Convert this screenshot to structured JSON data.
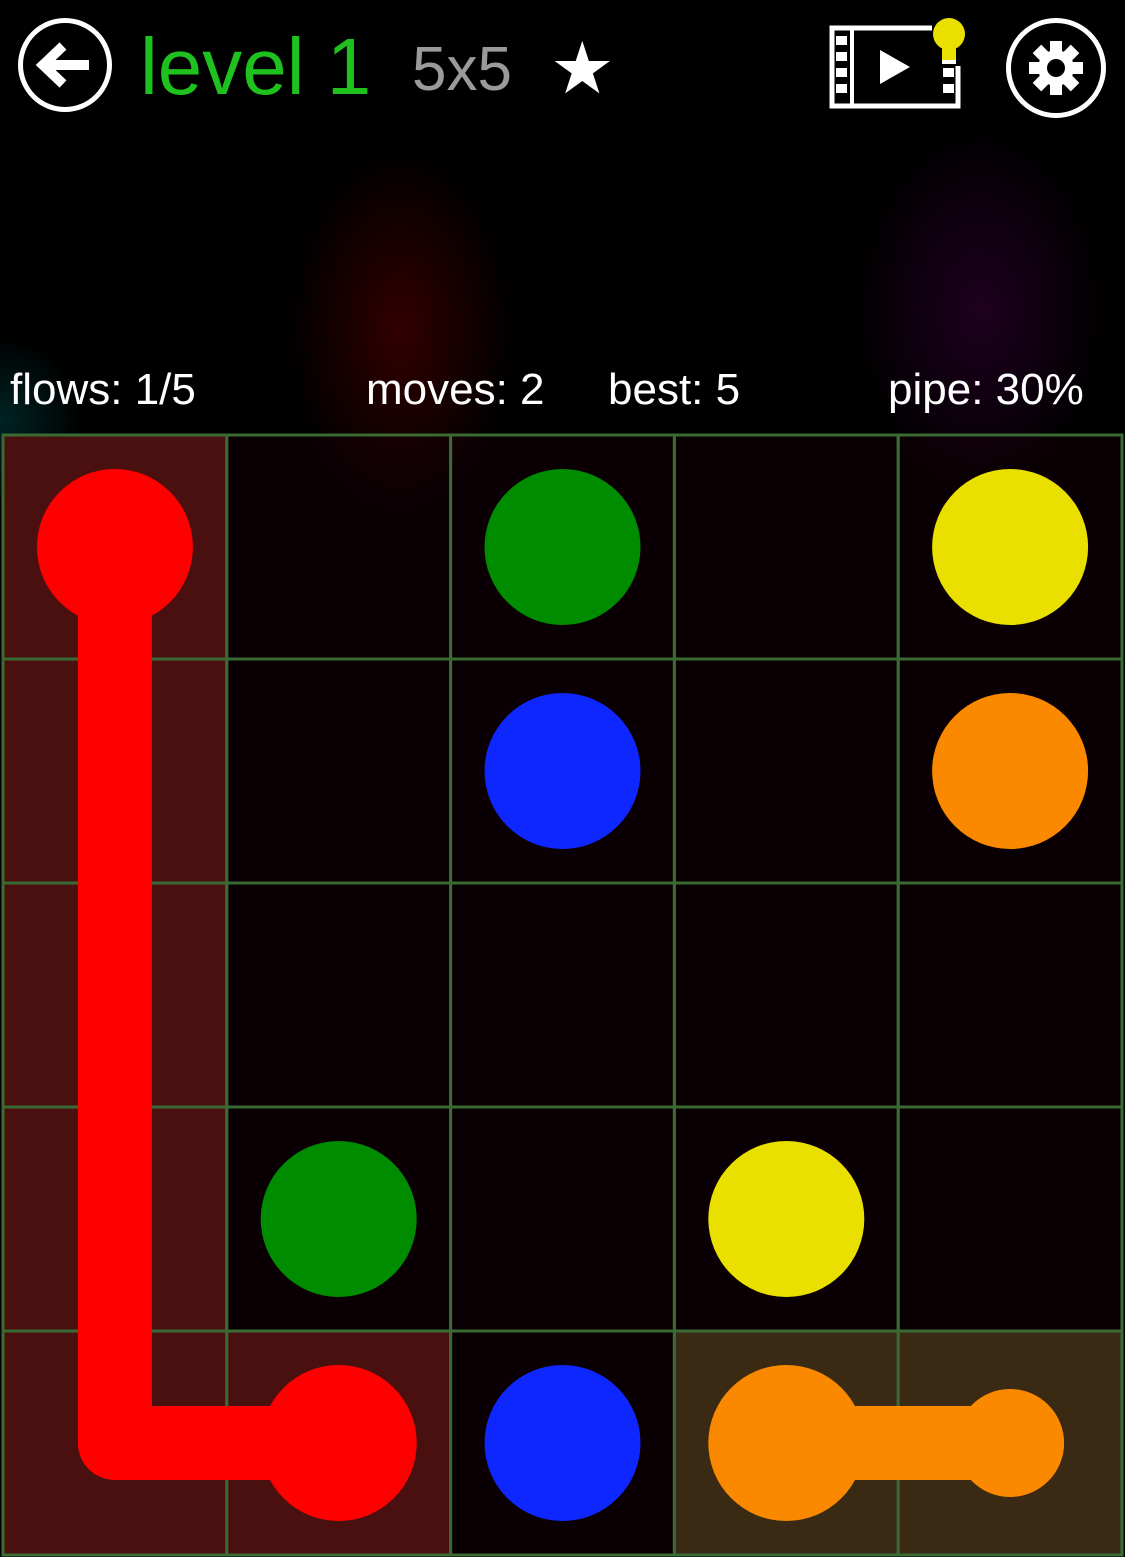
{
  "header": {
    "level_title": "level 1",
    "grid_size": "5x5",
    "star": "★",
    "icons": {
      "back": "arrow-left-icon",
      "hint": "video-hint-lightbulb-icon",
      "settings": "gear-icon"
    }
  },
  "stats": {
    "flows": "flows: 1/5",
    "moves": "moves: 2",
    "best": "best: 5",
    "pipe": "pipe: 30%"
  },
  "board": {
    "rows": 5,
    "cols": 5,
    "grid_color": "#3a6b35",
    "colors": {
      "red": "#ff0000",
      "green": "#008c00",
      "yellow": "#eae000",
      "blue": "#0f27ff",
      "orange": "#fb8900"
    },
    "tints": {
      "red": "#4a1010",
      "orange": "#3a2a14"
    },
    "dots": [
      {
        "color": "red",
        "row": 0,
        "col": 0
      },
      {
        "color": "red",
        "row": 4,
        "col": 1
      },
      {
        "color": "green",
        "row": 0,
        "col": 2
      },
      {
        "color": "green",
        "row": 3,
        "col": 1
      },
      {
        "color": "yellow",
        "row": 0,
        "col": 4
      },
      {
        "color": "yellow",
        "row": 3,
        "col": 3
      },
      {
        "color": "blue",
        "row": 1,
        "col": 2
      },
      {
        "color": "blue",
        "row": 4,
        "col": 2
      },
      {
        "color": "orange",
        "row": 1,
        "col": 4
      },
      {
        "color": "orange",
        "row": 4,
        "col": 3
      }
    ],
    "paths": [
      {
        "color": "red",
        "cells": [
          [
            0,
            0
          ],
          [
            1,
            0
          ],
          [
            2,
            0
          ],
          [
            3,
            0
          ],
          [
            4,
            0
          ],
          [
            4,
            1
          ]
        ],
        "complete": true
      },
      {
        "color": "orange",
        "cells": [
          [
            4,
            3
          ],
          [
            4,
            4
          ]
        ],
        "complete": false
      }
    ]
  }
}
